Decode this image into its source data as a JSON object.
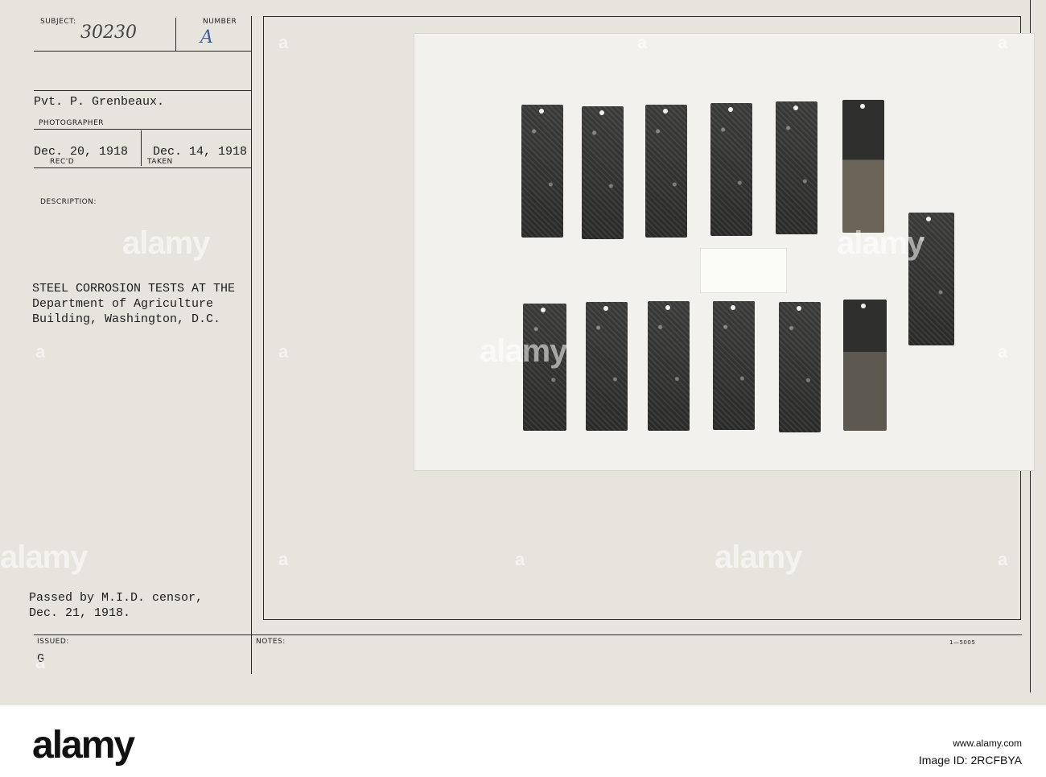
{
  "card": {
    "subject_label": "SUBJECT:",
    "subject_number": "30230",
    "number_label": "NUMBER",
    "number_value": "A",
    "photographer_name": "Pvt. P. Grenbeaux.",
    "photographer_label": "PHOTOGRAPHER",
    "recd_date": "Dec. 20, 1918",
    "recd_label": "REC'D",
    "taken_date": "Dec. 14, 1918",
    "taken_label": "TAKEN",
    "description_label": "DESCRIPTION:",
    "description_lines": [
      "STEEL CORROSION TESTS AT THE",
      "Department of Agriculture",
      "Building, Washington, D.C."
    ],
    "censor_lines": [
      "Passed by M.I.D. censor,",
      "Dec. 21, 1918."
    ],
    "issued_label": "ISSUED:",
    "issued_value": "G",
    "notes_label": "NOTES:",
    "form_number": "1—5005"
  },
  "watermark": "alamy",
  "footer": {
    "logo": "alamy",
    "image_id": "Image ID: 2RCFBYA",
    "url": "www.alamy.com"
  }
}
